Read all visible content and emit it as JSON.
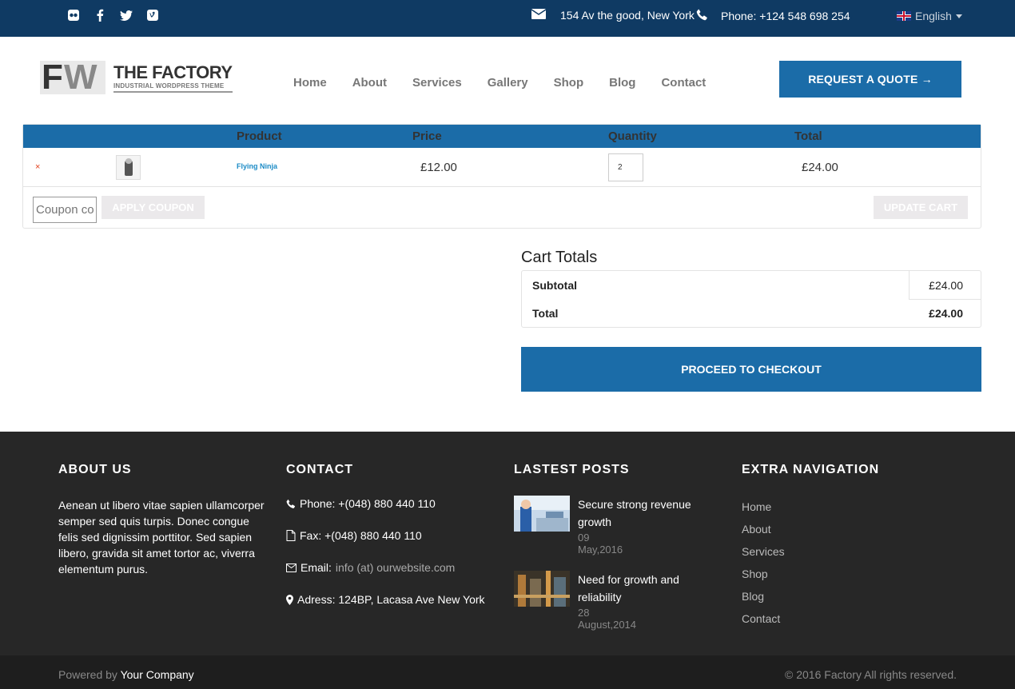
{
  "topbar": {
    "social_icons": [
      "flickr-icon",
      "facebook-icon",
      "twitter-icon",
      "vimeo-icon"
    ],
    "address": "154 Av the good, New York",
    "phone": "Phone: +124 548 698 254",
    "language": "English"
  },
  "header": {
    "logo_mark": "FW",
    "logo_title": "THE FACTORY",
    "logo_subtitle": "INDUSTRIAL WORDPRESS THEME",
    "nav": [
      "Home",
      "About",
      "Services",
      "Gallery",
      "Shop",
      "Blog",
      "Contact"
    ],
    "cta_label": "REQUEST A QUOTE →"
  },
  "cart": {
    "columns": {
      "product": "Product",
      "price": "Price",
      "quantity": "Quantity",
      "total": "Total"
    },
    "items": [
      {
        "remove": "×",
        "name": "Flying Ninja",
        "price": "£12.00",
        "quantity": "2",
        "total": "£24.00"
      }
    ],
    "coupon_placeholder": "Coupon code",
    "apply_coupon": "APPLY COUPON",
    "update_cart": "UPDATE CART"
  },
  "totals": {
    "title": "Cart Totals",
    "subtotal_label": "Subtotal",
    "subtotal_value": "£24.00",
    "total_label": "Total",
    "total_value": "£24.00",
    "checkout_label": "PROCEED TO CHECKOUT"
  },
  "footer": {
    "about": {
      "heading": "ABOUT US",
      "text": "Aenean ut libero vitae sapien ullamcorper semper sed quis turpis. Donec congue felis sed dignissim porttitor. Sed sapien libero, gravida sit amet tortor ac, viverra elementum purus."
    },
    "contact": {
      "heading": "CONTACT",
      "phone": "Phone: +(048) 880 440 110",
      "fax": "Fax: +(048) 880 440 110",
      "email_label": "Email:",
      "email_value": "info (at) ourwebsite.com",
      "address": "Adress: 124BP, Lacasa Ave New York"
    },
    "posts": {
      "heading": "LASTEST POSTS",
      "items": [
        {
          "title": "Secure strong revenue growth",
          "date": "09 May,2016"
        },
        {
          "title": "Need for growth and reliability",
          "date": "28 August,2014"
        }
      ]
    },
    "extra_nav": {
      "heading": "EXTRA NAVIGATION",
      "links": [
        "Home",
        "About",
        "Services",
        "Shop",
        "Blog",
        "Contact"
      ]
    },
    "powered_prefix": "Powered by",
    "powered_company": "Your Company",
    "copyright": "© 2016 Factory All rights reserved."
  },
  "colors": {
    "topbar": "#0f3a63",
    "primary": "#1b6ca8",
    "footer": "#272727",
    "bottombar": "#1e1e1e"
  }
}
